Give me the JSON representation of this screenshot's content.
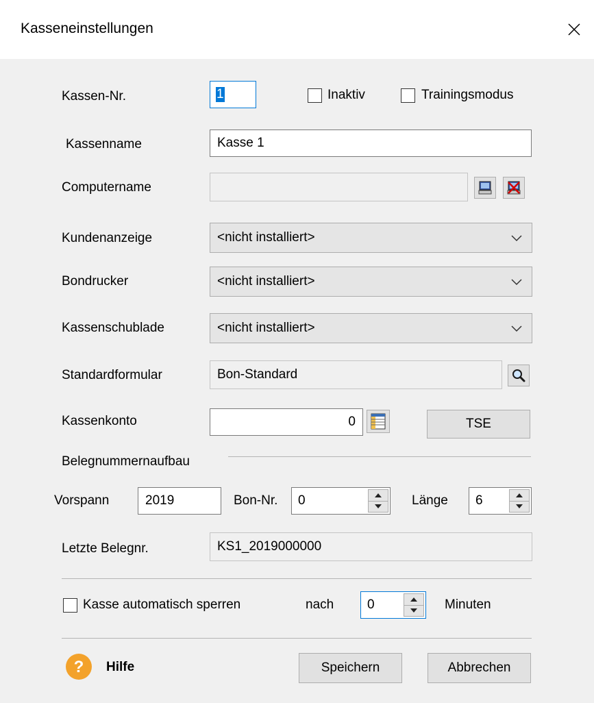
{
  "window": {
    "title": "Kasseneinstellungen"
  },
  "fields": {
    "kassen_nr": {
      "label": "Kassen-Nr.",
      "value": "1"
    },
    "inaktiv": {
      "label": "Inaktiv",
      "checked": false
    },
    "trainingsmodus": {
      "label": "Trainingsmodus",
      "checked": false
    },
    "kassenname": {
      "label": "Kassenname",
      "value": "Kasse 1"
    },
    "computername": {
      "label": "Computername",
      "value": ""
    },
    "kundenanzeige": {
      "label": "Kundenanzeige",
      "value": "<nicht installiert>"
    },
    "bondrucker": {
      "label": "Bondrucker",
      "value": "<nicht installiert>"
    },
    "kassenschublade": {
      "label": "Kassenschublade",
      "value": "<nicht installiert>"
    },
    "standardformular": {
      "label": "Standardformular",
      "value": "Bon-Standard"
    },
    "kassenkonto": {
      "label": "Kassenkonto",
      "value": "0"
    },
    "tse_button": "TSE"
  },
  "belegnummer": {
    "section_label": "Belegnummernaufbau",
    "vorspann_label": "Vorspann",
    "vorspann_value": "2019",
    "bon_nr_label": "Bon-Nr.",
    "bon_nr_value": "0",
    "laenge_label": "Länge",
    "laenge_value": "6",
    "letzte_label": "Letzte Belegnr.",
    "letzte_value": "KS1_2019000000"
  },
  "autolock": {
    "label": "Kasse automatisch sperren",
    "checked": false,
    "nach_label": "nach",
    "value": "0",
    "unit_label": "Minuten"
  },
  "footer": {
    "help_label": "Hilfe",
    "save_label": "Speichern",
    "cancel_label": "Abbrechen"
  },
  "colors": {
    "help_icon": "#f3a22b",
    "focus_border": "#0078d7"
  }
}
